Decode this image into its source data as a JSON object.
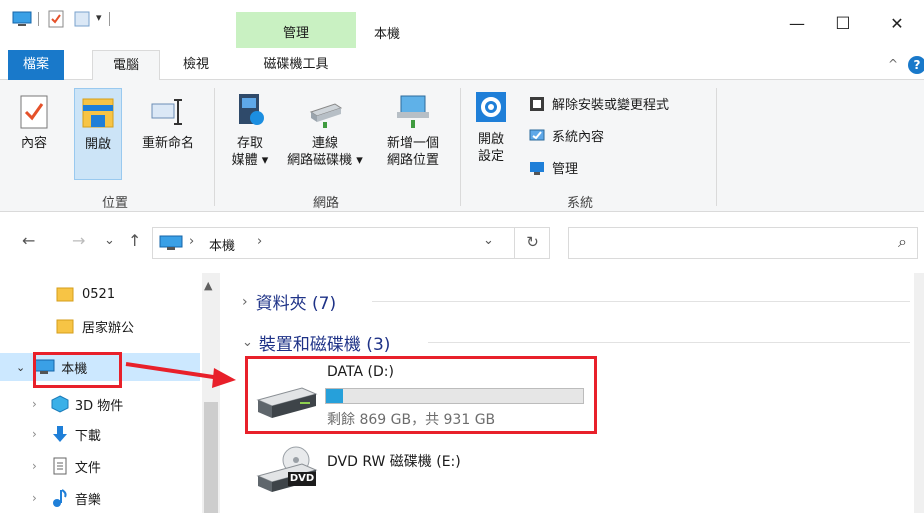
{
  "window": {
    "context_tab": "管理",
    "title": "本機",
    "minimize": "—",
    "maximize": "☐",
    "close": "✕"
  },
  "tabs": {
    "file": "檔案",
    "computer": "電腦",
    "view": "檢視",
    "drive_tools": "磁碟機工具",
    "collapse": "^",
    "help": "?"
  },
  "ribbon": {
    "location": {
      "label": "位置",
      "properties": "內容",
      "open": "開啟",
      "rename": "重新命名"
    },
    "network": {
      "label": "網路",
      "access_media_1": "存取",
      "access_media_2": "媒體",
      "map_drive_1": "連線",
      "map_drive_2": "網路磁碟機",
      "add_location_1": "新增一個",
      "add_location_2": "網路位置"
    },
    "system": {
      "label": "系統",
      "open_settings_1": "開啟",
      "open_settings_2": "設定",
      "uninstall": "解除安裝或變更程式",
      "system_properties": "系統內容",
      "manage": "管理"
    }
  },
  "address": {
    "back": "←",
    "forward": "→",
    "recent": "⌄",
    "up": "↑",
    "separator": "›",
    "path": "本機",
    "dropdown": "⌄",
    "refresh": "↻",
    "search_icon": "⌕"
  },
  "nav": {
    "items": [
      {
        "label": "0521"
      },
      {
        "label": "居家辦公"
      },
      {
        "label": "本機"
      },
      {
        "label": "3D 物件"
      },
      {
        "label": "下載"
      },
      {
        "label": "文件"
      },
      {
        "label": "音樂"
      }
    ]
  },
  "content": {
    "folders_header": "資料夾 (7)",
    "devices_header": "裝置和磁碟機 (3)",
    "drives": [
      {
        "name": "DATA (D:)",
        "free": "剩餘 869 GB，共 931 GB",
        "used_fraction": 0.067
      },
      {
        "name": "DVD RW 磁碟機 (E:)"
      }
    ],
    "dvd_badge": "DVD"
  },
  "colors": {
    "accent": "#1979ca",
    "selection": "#cce8ff",
    "highlight_box": "#e8202a",
    "context_tab": "#c9f1c2",
    "progress": "#26a0da"
  }
}
